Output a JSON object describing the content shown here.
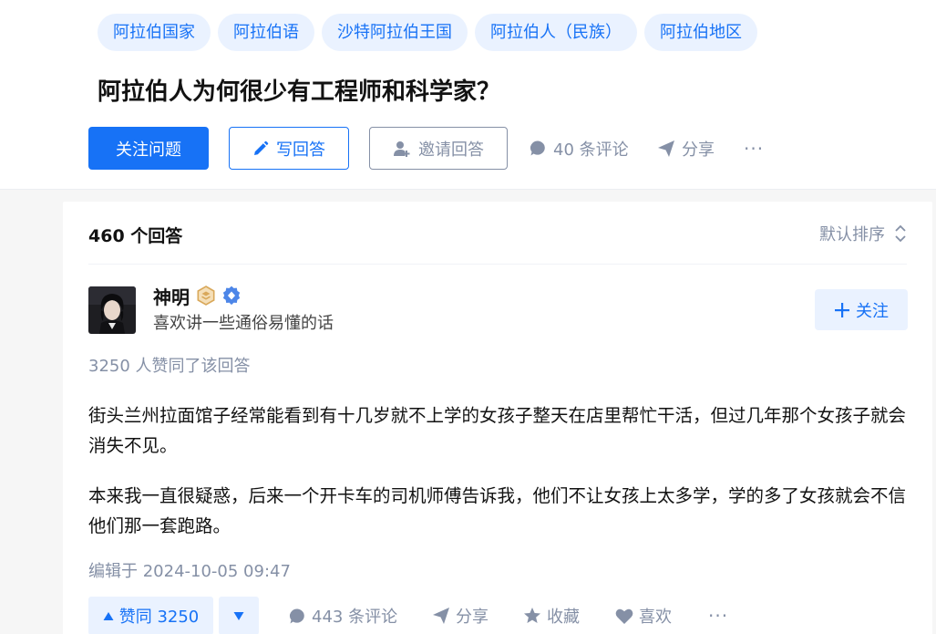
{
  "topics": [
    "阿拉伯国家",
    "阿拉伯语",
    "沙特阿拉伯王国",
    "阿拉伯人（民族）",
    "阿拉伯地区"
  ],
  "question": {
    "title": "阿拉伯人为何很少有工程师和科学家？",
    "follow_label": "关注问题",
    "write_label": "写回答",
    "invite_label": "邀请回答",
    "comments_label": "40 条评论",
    "share_label": "分享",
    "more_label": "···"
  },
  "answers_header": {
    "count_label": "460 个回答",
    "sort_label": "默认排序"
  },
  "answer": {
    "author_name": "神明",
    "author_bio": "喜欢讲一些通俗易懂的话",
    "follow_label": "关注",
    "voters_text": "3250 人赞同了该回答",
    "paragraphs": [
      "街头兰州拉面馆子经常能看到有十几岁就不上学的女孩子整天在店里帮忙干活，但过几年那个女孩子就会消失不见。",
      "本来我一直很疑惑，后来一个开卡车的司机师傅告诉我，他们不让女孩上太多学，学的多了女孩就会不信他们那一套跑路。"
    ],
    "edit_time": "编辑于 2024-10-05 09:47",
    "vote_up_label": "赞同 3250",
    "comments_label": "443 条评论",
    "share_label": "分享",
    "collect_label": "收藏",
    "like_label": "喜欢",
    "more_label": "···"
  },
  "colors": {
    "accent": "#1772f6",
    "accent_light": "#eaf2ff",
    "muted": "#8590a6",
    "page_bg": "#f6f6f6"
  },
  "icons": [
    "pencil-icon",
    "add-user-icon",
    "comment-icon",
    "share-icon",
    "more-icon",
    "sort-icon",
    "plus-icon",
    "triangle-up-icon",
    "triangle-down-icon",
    "star-icon",
    "heart-icon",
    "badge-gold-icon",
    "badge-verified-icon"
  ]
}
